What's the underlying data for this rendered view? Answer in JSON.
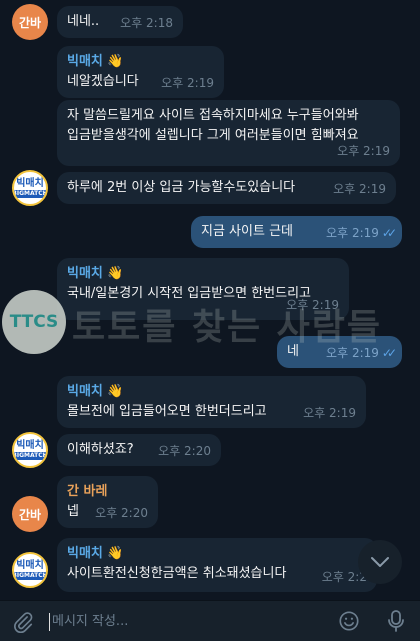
{
  "messages": [
    {
      "sender_initials": "간바",
      "text": "네네..",
      "time": "오후 2:18"
    },
    {
      "sender": "빅매치",
      "badge": "👋",
      "text": "네알겠습니다",
      "time": "오후 2:19"
    },
    {
      "lines": [
        "자 말씀드릴게요 사이트 접속하지마세요 누구들어와봐",
        "입금받을생각에 설렙니다 그게 여러분들이면 힘빠져요"
      ],
      "time": "오후 2:19"
    },
    {
      "text": "하루에 2번 이상 입금 가능할수도있습니다",
      "time": "오후 2:19",
      "avatar_line1": "빅매치",
      "avatar_line2": "BIGMATCH"
    },
    {
      "text": "지금 사이트 근데",
      "time": "오후 2:19",
      "checks": "✓✓"
    },
    {
      "sender": "빅매치",
      "badge": "👋",
      "text": "국내/일본경기 시작전 입금받으면 한번드리고",
      "time": "오후 2:19"
    },
    {
      "text": "네",
      "time": "오후 2:19",
      "checks": "✓✓"
    },
    {
      "sender": "빅매치",
      "badge": "👋",
      "text": "몰브전에 입금들어오면 한번더드리고",
      "time": "오후 2:19"
    },
    {
      "text": "이해하셨죠?",
      "time": "오후 2:20",
      "avatar_line1": "빅매치",
      "avatar_line2": "BIGMATCH"
    },
    {
      "sender": "간 바레",
      "text": "넵",
      "time": "오후 2:20",
      "avatar_initials": "간바"
    },
    {
      "sender": "빅매치",
      "badge": "👋",
      "text": "사이트환전신청한금액은 취소돼셨습니다",
      "time": "오후 2:2",
      "avatar_line1": "빅매치",
      "avatar_line2": "BIGMATCH"
    }
  ],
  "watermark": {
    "logo": "TTCS",
    "text": "토토를 찾는 사람들"
  },
  "composer": {
    "placeholder": "메시지 작성..."
  },
  "icons": {
    "attach": "paperclip-icon",
    "emoji": "smile-icon",
    "mic": "microphone-icon",
    "scroll": "chevron-down-icon",
    "read": "double-check-icon"
  },
  "colors": {
    "background": "#0e1621",
    "incoming": "#182533",
    "outgoing": "#2b5278",
    "sender_blue": "#5aa9e6",
    "sender_orange": "#e9a25a",
    "avatar_orange": "#e8864a"
  }
}
